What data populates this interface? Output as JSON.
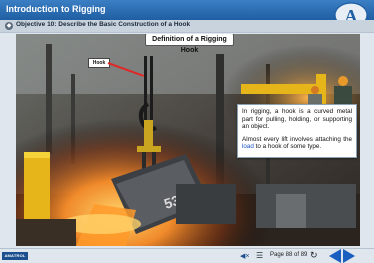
{
  "window": {
    "title": "Introduction to Rigging"
  },
  "objective": {
    "label": "Objective 10: Describe the Basic Construction of a Hook"
  },
  "slide": {
    "heading": "Definition of a Rigging Hook",
    "callout_label": "Hook",
    "paragraph1": "In rigging, a hook is a curved metal part for pulling, holding, or supporting an object.",
    "paragraph2_before": "Almost every lift involves attaching the ",
    "paragraph2_keyword": "load",
    "paragraph2_after": " to a hook of some type."
  },
  "footer": {
    "logo_text": "AMATROL",
    "page_indicator": "Page 88 of 89"
  },
  "icons": {
    "brand": "amatrol-a-logo-icon",
    "objective": "objective-icon",
    "audio": "speaker-mute-icon",
    "menu": "hamburger-menu-icon",
    "refresh": "refresh-icon",
    "prev": "previous-arrow-icon",
    "next": "next-arrow-icon"
  },
  "colors": {
    "header": "#2a6db3",
    "accent": "#1a5fbf",
    "keyword": "#1a55c7",
    "pointer": "#e12828"
  }
}
